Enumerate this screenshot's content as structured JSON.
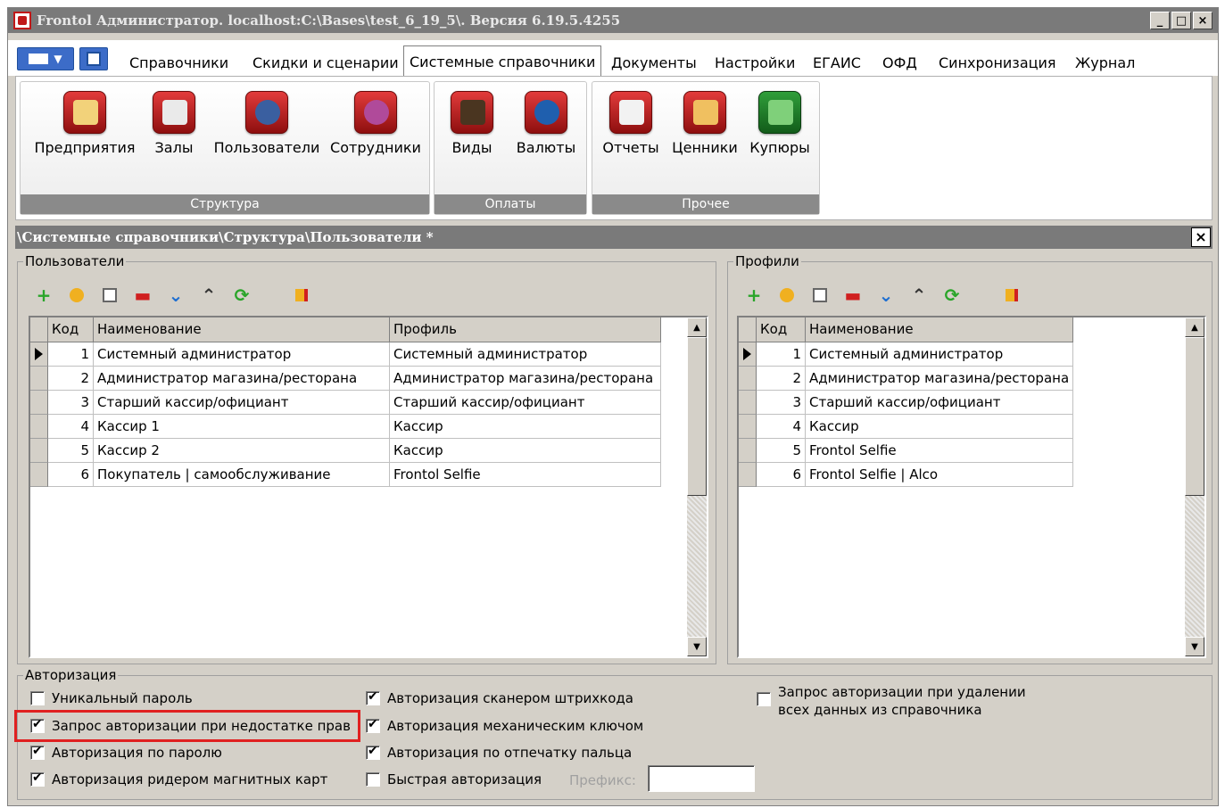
{
  "window": {
    "title": "Frontol Администратор. localhost:C:\\Bases\\test_6_19_5\\. Версия 6.19.5.4255",
    "controls": [
      "_",
      "□",
      "×"
    ]
  },
  "menu": {
    "tabs": [
      "Справочники",
      "Скидки и сценарии",
      "Системные справочники",
      "Документы",
      "Настройки",
      "ЕГАИС",
      "ОФД",
      "Синхронизация",
      "Журнал"
    ],
    "active_tab": "Системные справочники"
  },
  "ribbon": {
    "groups": [
      {
        "title": "Структура",
        "buttons": [
          "Предприятия",
          "Залы",
          "Пользователи",
          "Сотрудники"
        ]
      },
      {
        "title": "Оплаты",
        "buttons": [
          "Виды",
          "Валюты"
        ]
      },
      {
        "title": "Прочее",
        "buttons": [
          "Отчеты",
          "Ценники",
          "Купюры"
        ]
      }
    ]
  },
  "document": {
    "path": "\\Системные справочники\\Структура\\Пользователи *",
    "close": "×"
  },
  "users": {
    "legend": "Пользователи",
    "columns": [
      "Код",
      "Наименование",
      "Профиль"
    ],
    "rows": [
      {
        "code": "1",
        "name": "Системный администратор",
        "profile": "Системный администратор"
      },
      {
        "code": "2",
        "name": "Администратор магазина/ресторана",
        "profile": "Администратор магазина/ресторана"
      },
      {
        "code": "3",
        "name": "Старший кассир/официант",
        "profile": "Старший кассир/официант"
      },
      {
        "code": "4",
        "name": "Кассир 1",
        "profile": "Кассир"
      },
      {
        "code": "5",
        "name": "Кассир 2",
        "profile": "Кассир"
      },
      {
        "code": "6",
        "name": "Покупатель | самообслуживание",
        "profile": "Frontol Selfie"
      }
    ]
  },
  "profiles": {
    "legend": "Профили",
    "columns": [
      "Код",
      "Наименование"
    ],
    "rows": [
      {
        "code": "1",
        "name": "Системный администратор"
      },
      {
        "code": "2",
        "name": "Администратор магазина/ресторана"
      },
      {
        "code": "3",
        "name": "Старший кассир/официант"
      },
      {
        "code": "4",
        "name": "Кассир"
      },
      {
        "code": "5",
        "name": "Frontol Selfie"
      },
      {
        "code": "6",
        "name": "Frontol Selfie | Alco"
      }
    ]
  },
  "auth": {
    "legend": "Авторизация",
    "unique_password": {
      "label": "Уникальный пароль",
      "checked": false
    },
    "request_on_lack": {
      "label": "Запрос авторизации при недостатке прав",
      "checked": true
    },
    "by_password": {
      "label": "Авторизация по паролю",
      "checked": true
    },
    "by_mag_reader": {
      "label": "Авторизация ридером магнитных карт",
      "checked": true
    },
    "by_barcode": {
      "label": "Авторизация сканером штрихкода",
      "checked": true
    },
    "by_mech_key": {
      "label": "Авторизация механическим ключом",
      "checked": true
    },
    "by_fingerprint": {
      "label": "Авторизация по отпечатку пальца",
      "checked": true
    },
    "quick": {
      "label": "Быстрая авторизация",
      "checked": false
    },
    "prefix_label": "Префикс:",
    "prefix_value": "",
    "request_on_delete": {
      "label_line1": "Запрос авторизации при удалении",
      "label_line2": "всех данных из справочника",
      "checked": false
    }
  },
  "colors": {
    "highlight": "#e02020",
    "icon_red": "#c01818",
    "icon_green": "#2f9e3a",
    "caption_gray": "#7a7a7a"
  }
}
